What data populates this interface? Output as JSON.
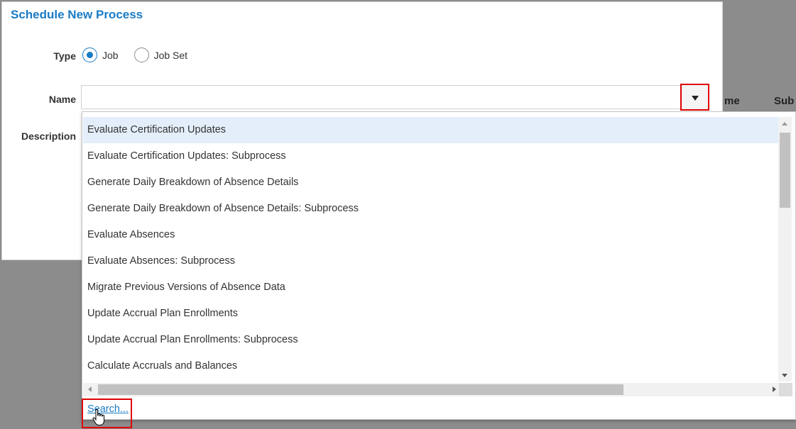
{
  "background": {
    "header_col1": "me",
    "header_col2": "Sub"
  },
  "dialog": {
    "title": "Schedule New Process",
    "type_label": "Type",
    "type_options": [
      {
        "label": "Job",
        "selected": true
      },
      {
        "label": "Job Set",
        "selected": false
      }
    ],
    "name_label": "Name",
    "name_value": "",
    "description_label": "Description"
  },
  "dropdown": {
    "items": [
      "Evaluate Certification Updates",
      "Evaluate Certification Updates: Subprocess",
      "Generate Daily Breakdown of Absence Details",
      "Generate Daily Breakdown of Absence Details: Subprocess",
      "Evaluate Absences",
      "Evaluate Absences: Subprocess",
      "Migrate Previous Versions of Absence Data",
      "Update Accrual Plan Enrollments",
      "Update Accrual Plan Enrollments: Subprocess",
      "Calculate Accruals and Balances"
    ],
    "highlighted_index": 0,
    "search_link": "Search..."
  },
  "colors": {
    "accent": "#1a7bc4",
    "highlight_box": "#e00000",
    "row_highlight": "#e3eefa"
  },
  "icons": {
    "dropdown": "triangle-down-icon",
    "cursor": "hand-pointer-icon"
  }
}
